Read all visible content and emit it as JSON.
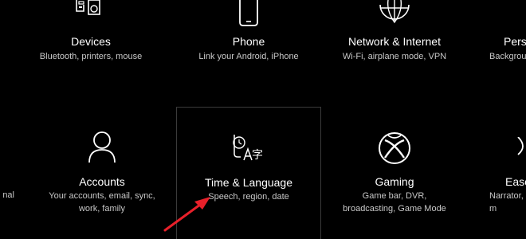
{
  "tiles": {
    "devices": {
      "title": "Devices",
      "desc": "Bluetooth, printers, mouse"
    },
    "phone": {
      "title": "Phone",
      "desc": "Link your Android, iPhone"
    },
    "network": {
      "title": "Network & Internet",
      "desc": "Wi-Fi, airplane mode, VPN"
    },
    "personalization": {
      "title": "Perso",
      "desc": "Backgrou"
    },
    "apps": {
      "desc": "nal"
    },
    "accounts": {
      "title": "Accounts",
      "desc": "Your accounts, email, sync, work, family"
    },
    "time_language": {
      "title": "Time & Language",
      "desc": "Speech, region, date"
    },
    "gaming": {
      "title": "Gaming",
      "desc": "Game bar, DVR, broadcasting, Game Mode"
    },
    "ease": {
      "title": "Ease",
      "desc": "Narrator, m"
    }
  },
  "colors": {
    "background": "#000000",
    "arrow": "#e8202a",
    "focus_border": "#3a3a3a"
  }
}
